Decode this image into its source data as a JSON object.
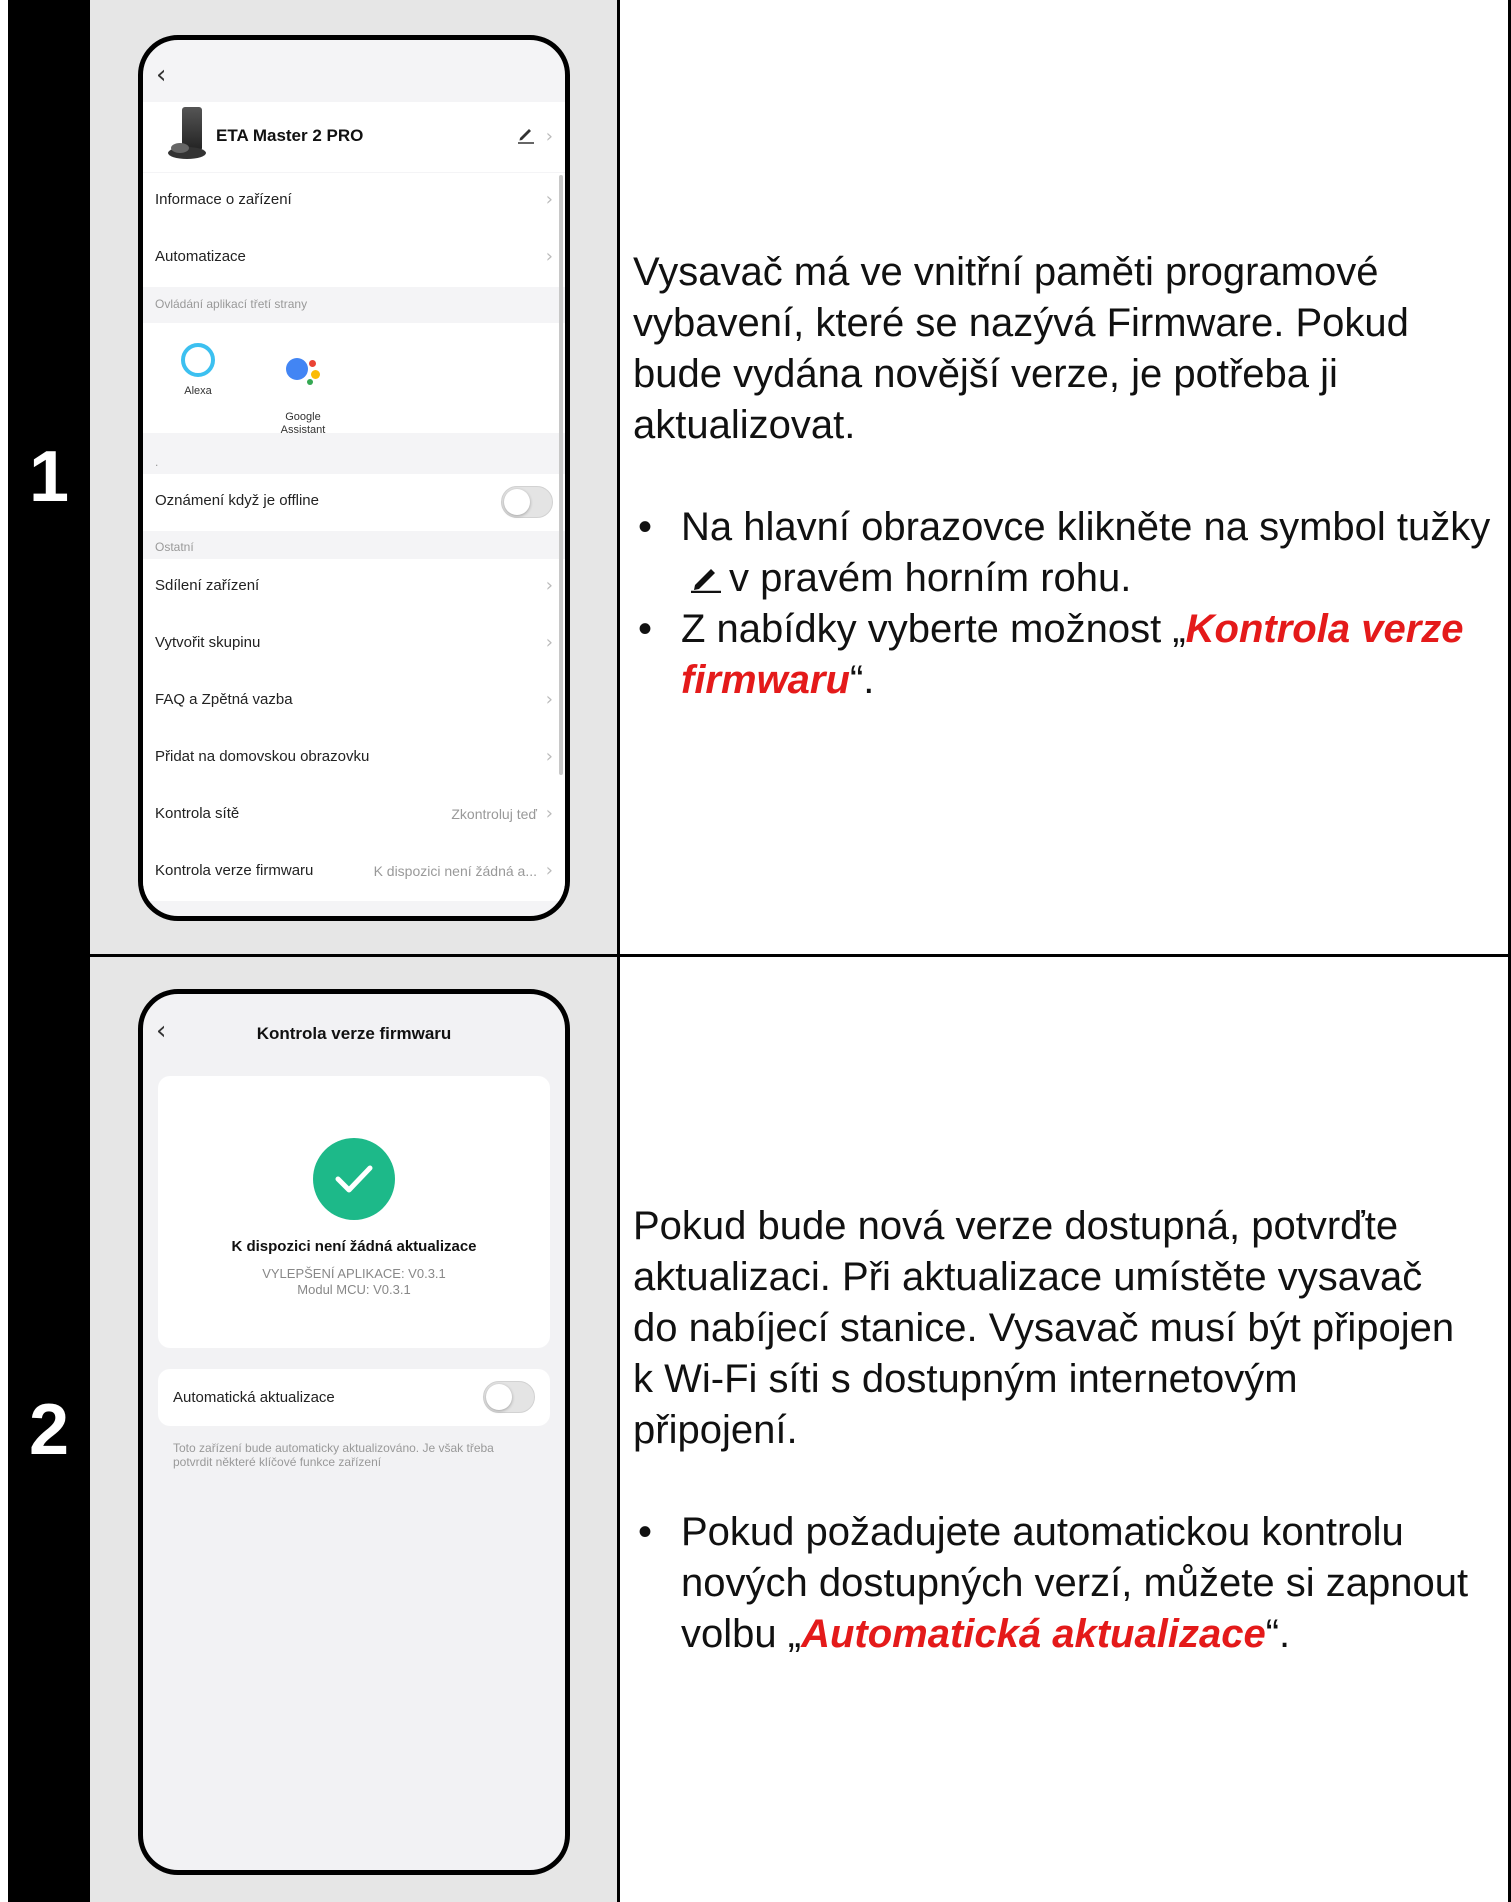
{
  "steps": [
    {
      "number": "1",
      "phone": {
        "device_name": "ETA Master 2 PRO",
        "menu": [
          {
            "label": "Informace o zařízení"
          },
          {
            "label": "Automatizace"
          }
        ],
        "third_party_section": "Ovládání aplikací třetí strany",
        "third_party": [
          {
            "label": "Alexa"
          },
          {
            "label": "Google\nAssistant"
          }
        ],
        "dot_section": ".",
        "offline_label": "Oznámení když je offline",
        "other_section": "Ostatní",
        "other_menu": [
          {
            "label": "Sdílení zařízení"
          },
          {
            "label": "Vytvořit skupinu"
          },
          {
            "label": "FAQ a Zpětná vazba"
          },
          {
            "label": "Přidat na domovskou obrazovku"
          }
        ],
        "network_label": "Kontrola sítě",
        "network_value": "Zkontroluj teď",
        "firmware_label": "Kontrola verze firmwaru",
        "firmware_value": "K dispozici není žádná a..."
      },
      "text": {
        "paragraph": "Vysavač má ve vnitřní paměti programové vybavení, které se nazývá Firmware. Pokud bude vydána novější verze, je potřeba ji aktualizovat.",
        "bullet1_before": "Na hlavní obrazovce klikněte na symbol tužky",
        "bullet1_after": "v pravém horním rohu.",
        "bullet2_before": "Z nabídky vyberte možnost „",
        "bullet2_em": "Kontrola verze firmwaru",
        "bullet2_after": "“."
      }
    },
    {
      "number": "2",
      "phone": {
        "title": "Kontrola verze firmwaru",
        "status_title": "K dispozici není žádná aktualizace",
        "app_version": "VYLEPŠENÍ APLIKACE: V0.3.1",
        "mcu_version": "Modul MCU: V0.3.1",
        "auto_label": "Automatická aktualizace",
        "auto_note": "Toto zařízení bude automaticky aktualizováno. Je však třeba potvrdit některé klíčové funkce zařízení"
      },
      "text": {
        "paragraph": "Pokud bude nová verze dostupná, potvrďte aktualizaci. Při aktualizace umístěte vysavač do nabíjecí stanice. Vysavač musí být připojen k Wi-Fi síti s dostupným internetovým připojení.",
        "bullet1_before": "Pokud požadujete automatickou kontrolu nových dostupných verzí, můžete si zapnout volbu „",
        "bullet1_em": "Automatická aktualizace",
        "bullet1_after": "“."
      }
    }
  ],
  "colors": {
    "highlight": "#e41a1a",
    "check_green": "#1db989",
    "column_gray": "#e6e6e6"
  },
  "icons": [
    "back-icon",
    "pencil-icon",
    "chevron-right-icon",
    "alexa-icon",
    "google-assistant-icon",
    "check-icon",
    "toggle-icon",
    "robot-vacuum-icon"
  ]
}
